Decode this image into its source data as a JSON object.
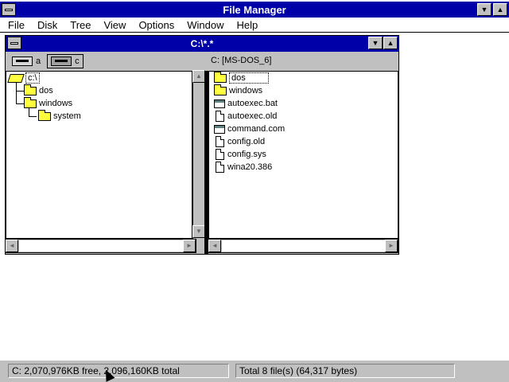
{
  "app": {
    "title": "File Manager"
  },
  "menu": [
    "File",
    "Disk",
    "Tree",
    "View",
    "Options",
    "Window",
    "Help"
  ],
  "child": {
    "title": "C:\\*.*",
    "volume_label": "C: [MS-DOS_6]",
    "drives": [
      {
        "letter": "a",
        "selected": false
      },
      {
        "letter": "c",
        "selected": true
      }
    ]
  },
  "tree": {
    "root": "c:\\",
    "items": [
      {
        "label": "dos"
      },
      {
        "label": "windows"
      },
      {
        "label": "system"
      }
    ]
  },
  "files": [
    {
      "name": "dos",
      "icon": "folder-icon"
    },
    {
      "name": "windows",
      "icon": "folder-icon"
    },
    {
      "name": "autoexec.bat",
      "icon": "program-file-icon"
    },
    {
      "name": "autoexec.old",
      "icon": "document-file-icon"
    },
    {
      "name": "command.com",
      "icon": "program-file-icon"
    },
    {
      "name": "config.old",
      "icon": "document-file-icon"
    },
    {
      "name": "config.sys",
      "icon": "document-file-icon"
    },
    {
      "name": "wina20.386",
      "icon": "document-file-icon"
    }
  ],
  "status": {
    "disk": "C: 2,070,976KB free,  2,096,160KB total",
    "files": "Total 8 file(s) (64,317 bytes)"
  },
  "colors": {
    "titlebar": "#0000a8",
    "folder": "#ffff40",
    "chrome": "#c0c0c0"
  }
}
